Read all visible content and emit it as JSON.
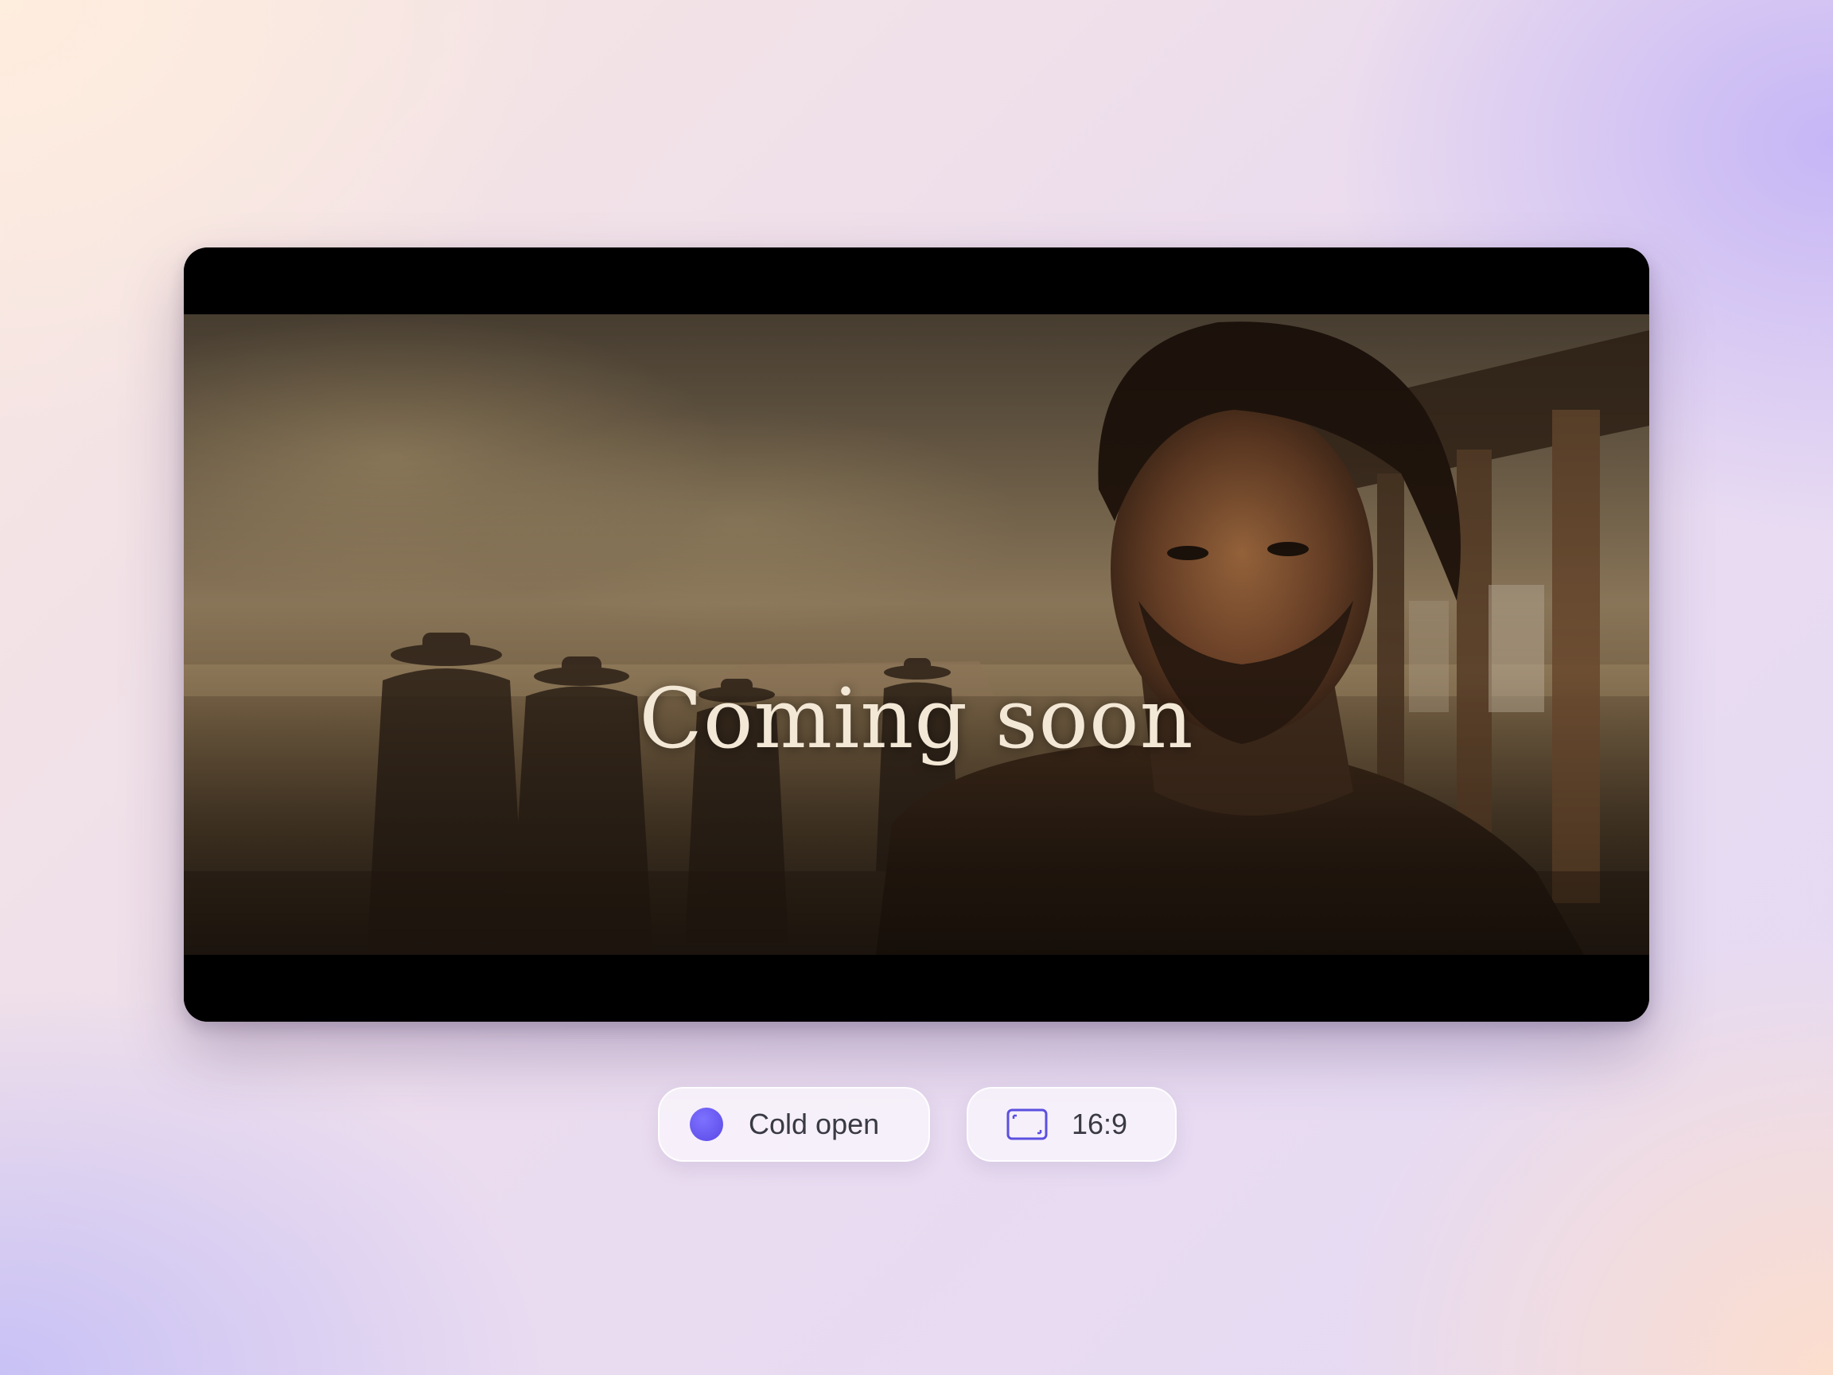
{
  "player": {
    "headline": "Coming soon"
  },
  "chips": {
    "scene": {
      "label": "Cold open",
      "dot_color": "#5f52ee"
    },
    "aspect_ratio": {
      "label": "16:9",
      "icon": "aspect-ratio-icon",
      "icon_color": "#5b4fe0"
    }
  },
  "colors": {
    "card_background": "#000000",
    "headline_color": "#f3e8d6",
    "accent": "#5f52ee"
  }
}
